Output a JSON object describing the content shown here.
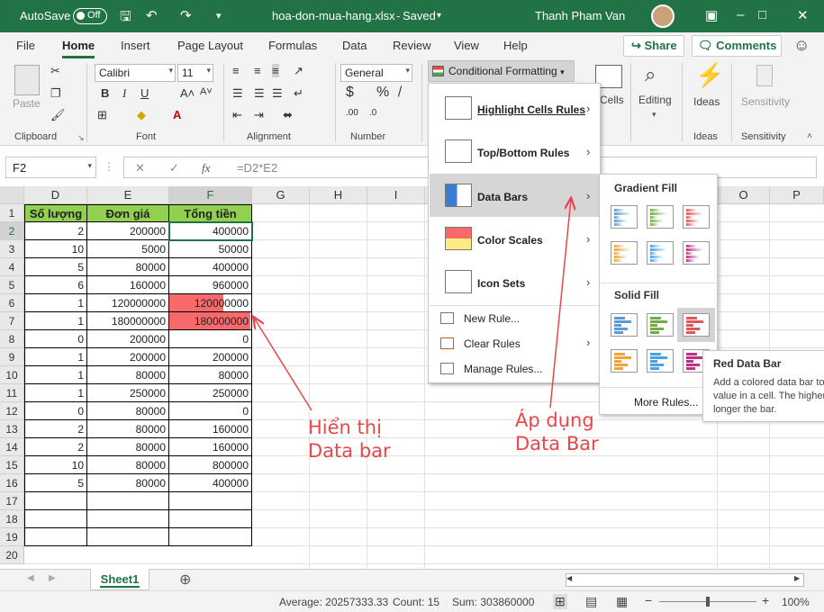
{
  "titlebar": {
    "autosave": "AutoSave",
    "toggle": "Off",
    "filename": "hoa-don-mua-hang.xlsx",
    "saved": "Saved",
    "user": "Thanh Pham Van"
  },
  "menu": {
    "tabs": [
      "File",
      "Home",
      "Insert",
      "Page Layout",
      "Formulas",
      "Data",
      "Review",
      "View",
      "Help"
    ],
    "active": "Home",
    "share": "Share",
    "comments": "Comments"
  },
  "ribbon": {
    "paste": "Paste",
    "font_name": "Calibri",
    "font_size": "11",
    "number_format": "General",
    "conditional_formatting": "Conditional Formatting",
    "cells": "Cells",
    "editing": "Editing",
    "ideas": "Ideas",
    "sensitivity": "Sensitivity",
    "groups": {
      "clipboard": "Clipboard",
      "font": "Font",
      "alignment": "Alignment",
      "number": "Number",
      "ideas": "Ideas",
      "sensitivity": "Sensitivity"
    }
  },
  "formula_bar": {
    "name_box": "F2",
    "formula": "=D2*E2"
  },
  "columns": [
    "D",
    "E",
    "F",
    "G",
    "H",
    "I",
    "O",
    "P"
  ],
  "sheet": {
    "headers": [
      "Số lượng",
      "Đơn giá",
      "Tổng tiền"
    ],
    "rows": [
      [
        "2",
        "200000",
        "400000"
      ],
      [
        "10",
        "5000",
        "50000"
      ],
      [
        "5",
        "80000",
        "400000"
      ],
      [
        "6",
        "160000",
        "960000"
      ],
      [
        "1",
        "120000000",
        "120000000"
      ],
      [
        "1",
        "180000000",
        "180000000"
      ],
      [
        "0",
        "200000",
        "0"
      ],
      [
        "1",
        "200000",
        "200000"
      ],
      [
        "1",
        "80000",
        "80000"
      ],
      [
        "1",
        "250000",
        "250000"
      ],
      [
        "0",
        "80000",
        "0"
      ],
      [
        "2",
        "80000",
        "160000"
      ],
      [
        "2",
        "80000",
        "160000"
      ],
      [
        "10",
        "80000",
        "800000"
      ],
      [
        "5",
        "80000",
        "400000"
      ],
      [
        "",
        "",
        ""
      ],
      [
        "",
        "",
        ""
      ],
      [
        "",
        "",
        ""
      ]
    ],
    "row_numbers": [
      "1",
      "2",
      "3",
      "4",
      "5",
      "6",
      "7",
      "8",
      "9",
      "10",
      "11",
      "12",
      "13",
      "14",
      "15",
      "16",
      "17",
      "18",
      "19",
      "20"
    ],
    "databar_fractions": [
      0.0022,
      0.0003,
      0.0022,
      0.0053,
      0.667,
      1.0,
      0,
      0.0011,
      0.0004,
      0.0014,
      0,
      0.0009,
      0.0009,
      0.0044,
      0.0022,
      0,
      0,
      0
    ],
    "databar_color": "#f8696b",
    "header_fill": "#92d050",
    "tab_name": "Sheet1"
  },
  "cf_menu": {
    "items": [
      {
        "label": "Highlight Cells Rules",
        "icon": "highlight-cells-icon"
      },
      {
        "label": "Top/Bottom Rules",
        "icon": "top-bottom-icon"
      },
      {
        "label": "Data Bars",
        "icon": "data-bars-icon"
      },
      {
        "label": "Color Scales",
        "icon": "color-scales-icon"
      },
      {
        "label": "Icon Sets",
        "icon": "icon-sets-icon"
      }
    ],
    "small_items": [
      "New Rule...",
      "Clear Rules",
      "Manage Rules..."
    ]
  },
  "submenu": {
    "gradient_fill": "Gradient Fill",
    "solid_fill": "Solid Fill",
    "more_rules": "More Rules...",
    "colors": [
      "#5b9bd5",
      "#70ad47",
      "#e15759",
      "#f2a33a",
      "#4aa3df",
      "#c0308a"
    ]
  },
  "tooltip": {
    "title": "Red Data Bar",
    "body": "Add a colored data bar to represent the value in a cell. The higher the value, the longer the bar."
  },
  "annotations": {
    "left_line1": "Hiển thị",
    "left_line2": "Data bar",
    "right_line1": "Áp dụng",
    "right_line2": "Data Bar",
    "color": "#e8474a"
  },
  "status": {
    "average": "Average: 20257333.33",
    "count": "Count: 15",
    "sum": "Sum: 303860000",
    "zoom": "100%"
  }
}
